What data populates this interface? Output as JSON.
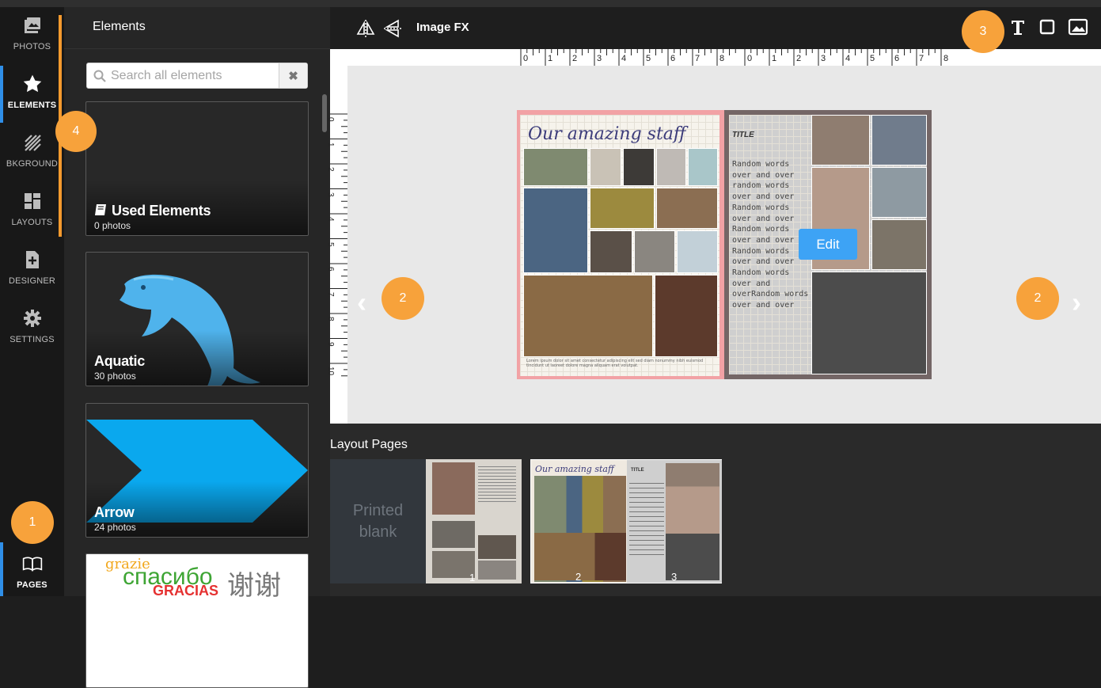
{
  "rail": {
    "items": [
      {
        "label": "PHOTOS",
        "icon": "photos-icon"
      },
      {
        "label": "ELEMENTS",
        "icon": "star-icon"
      },
      {
        "label": "BKGROUND",
        "icon": "hatch-icon"
      },
      {
        "label": "LAYOUTS",
        "icon": "layouts-icon"
      },
      {
        "label": "DESIGNER",
        "icon": "designer-icon"
      },
      {
        "label": "SETTINGS",
        "icon": "gear-icon"
      },
      {
        "label": "PAGES",
        "icon": "book-icon"
      }
    ],
    "active": "ELEMENTS"
  },
  "panel": {
    "title": "Elements",
    "search_placeholder": "Search all elements",
    "cards": [
      {
        "name": "Used Elements",
        "count": "0 photos"
      },
      {
        "name": "Aquatic",
        "count": "30 photos"
      },
      {
        "name": "Arrow",
        "count": "24 photos"
      },
      {
        "name": "",
        "count": ""
      }
    ],
    "thanks_words": [
      "grazie",
      "спасибо",
      "GRACIAS",
      "谢谢"
    ]
  },
  "toolbar": {
    "image_fx": "Image FX"
  },
  "ruler": {
    "top_ticks": [
      "0",
      "1",
      "2",
      "3",
      "4",
      "5",
      "6",
      "7",
      "8",
      "0",
      "1",
      "2",
      "3",
      "4",
      "5",
      "6",
      "7",
      "8"
    ],
    "left_ticks": [
      "0",
      "1",
      "2",
      "3",
      "4",
      "5",
      "6",
      "7",
      "8",
      "9",
      "10"
    ]
  },
  "spread": {
    "left_title": "Our amazing staff",
    "right_title": "TITLE",
    "right_text": [
      "Random words",
      "over and over",
      "random words",
      "over and over",
      "Random words",
      "over and over",
      "Random words",
      "over and over",
      "Random words",
      "over and over",
      "Random words",
      "over and",
      "overRandom words",
      "over and over"
    ],
    "caption": "Lorem ipsum dolor sit amet consectetur adipiscing elit sed diam nonummy nibh euismod tincidunt ut laoreet dolore magna aliquam erat volutpat."
  },
  "edit_label": "Edit",
  "badges": {
    "b1": "1",
    "b2l": "2",
    "b2r": "2",
    "b3": "3",
    "b4": "4"
  },
  "layout_pages": {
    "title": "Layout Pages",
    "blank_label": [
      "Printed",
      "blank"
    ],
    "page_numbers": [
      "1",
      "2",
      "3"
    ]
  },
  "colors": {
    "accent_orange": "#f7a23b",
    "edit_blue": "#3da3f5",
    "active_blue": "#2f8fe8"
  }
}
